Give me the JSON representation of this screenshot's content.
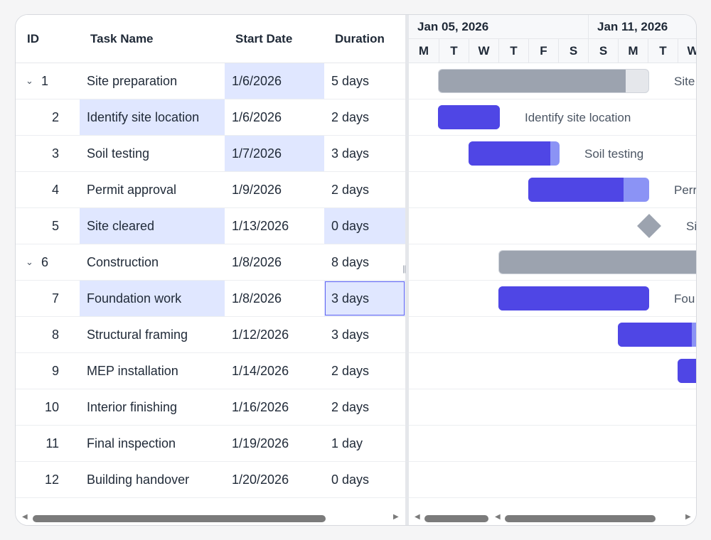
{
  "columns": {
    "id": "ID",
    "task_name": "Task Name",
    "start_date": "Start Date",
    "duration": "Duration"
  },
  "timeline": {
    "weeks": [
      "Jan 05, 2026",
      "Jan 11, 2026"
    ],
    "days": [
      "M",
      "T",
      "W",
      "T",
      "F",
      "S",
      "S",
      "M",
      "T",
      "W"
    ]
  },
  "tasks": [
    {
      "id": "1",
      "name": "Site preparation",
      "start": "1/6/2026",
      "duration": "5 days",
      "parent": true
    },
    {
      "id": "2",
      "name": "Identify site location",
      "start": "1/6/2026",
      "duration": "2 days"
    },
    {
      "id": "3",
      "name": "Soil testing",
      "start": "1/7/2026",
      "duration": "3 days"
    },
    {
      "id": "4",
      "name": "Permit approval",
      "start": "1/9/2026",
      "duration": "2 days"
    },
    {
      "id": "5",
      "name": "Site cleared",
      "start": "1/13/2026",
      "duration": "0 days"
    },
    {
      "id": "6",
      "name": "Construction",
      "start": "1/8/2026",
      "duration": "8 days",
      "parent": true
    },
    {
      "id": "7",
      "name": "Foundation work",
      "start": "1/8/2026",
      "duration": "3 days"
    },
    {
      "id": "8",
      "name": "Structural framing",
      "start": "1/12/2026",
      "duration": "3 days"
    },
    {
      "id": "9",
      "name": "MEP installation",
      "start": "1/14/2026",
      "duration": "2 days"
    },
    {
      "id": "10",
      "name": "Interior finishing",
      "start": "1/16/2026",
      "duration": "2 days"
    },
    {
      "id": "11",
      "name": "Final inspection",
      "start": "1/19/2026",
      "duration": "1 day"
    },
    {
      "id": "12",
      "name": "Building handover",
      "start": "1/20/2026",
      "duration": "0 days"
    }
  ],
  "bar_labels": {
    "r1": "Site",
    "r2": "Identify site location",
    "r3": "Soil testing",
    "r4": "Perr",
    "r5": "Si",
    "r7": "Fou"
  },
  "progress": {
    "r1": 0.89,
    "r2": 1.0,
    "r3": 0.9,
    "r4": 0.79,
    "r6": 1.0,
    "r7": 1.0,
    "r8": 0.8,
    "r9": 1.0
  },
  "icons": {
    "expand": "chevron-down-icon",
    "scroll_left": "arrow-left-icon",
    "scroll_right": "arrow-right-icon",
    "splitter": "grip-icon"
  },
  "colors": {
    "accent": "#4f46e5",
    "accent_light": "#8b93f5",
    "summary": "#9ca3af",
    "selected_cell": "#e0e7ff"
  }
}
